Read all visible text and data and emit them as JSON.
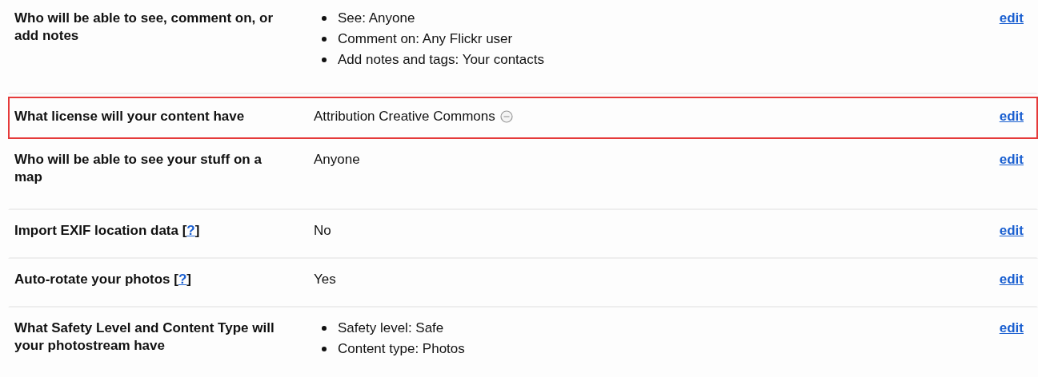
{
  "settings": [
    {
      "label": "Who will be able to see, comment on, or add notes",
      "highlighted": false,
      "value": {
        "kind": "list",
        "items": [
          "See: Anyone",
          "Comment on: Any Flickr user",
          "Add notes and tags: Your contacts"
        ]
      },
      "action": "edit"
    },
    {
      "label": "What license will your content have",
      "highlighted": true,
      "value": {
        "kind": "license",
        "text": "Attribution Creative Commons"
      },
      "action": "edit"
    },
    {
      "label": "Who will be able to see your stuff on a map",
      "highlighted": false,
      "value": {
        "kind": "text",
        "text": "Anyone"
      },
      "action": "edit"
    },
    {
      "label": "Import EXIF location data",
      "help": {
        "before": "[",
        "link": "?",
        "after": "]"
      },
      "highlighted": false,
      "value": {
        "kind": "text",
        "text": "No"
      },
      "action": "edit"
    },
    {
      "label": "Auto-rotate your photos",
      "help": {
        "before": "[",
        "link": "?",
        "after": "]"
      },
      "highlighted": false,
      "value": {
        "kind": "text",
        "text": "Yes"
      },
      "action": "edit"
    },
    {
      "label": "What Safety Level and Content Type will your photostream have",
      "highlighted": false,
      "value": {
        "kind": "list",
        "items": [
          "Safety level: Safe",
          "Content type: Photos"
        ]
      },
      "action": "edit"
    }
  ]
}
